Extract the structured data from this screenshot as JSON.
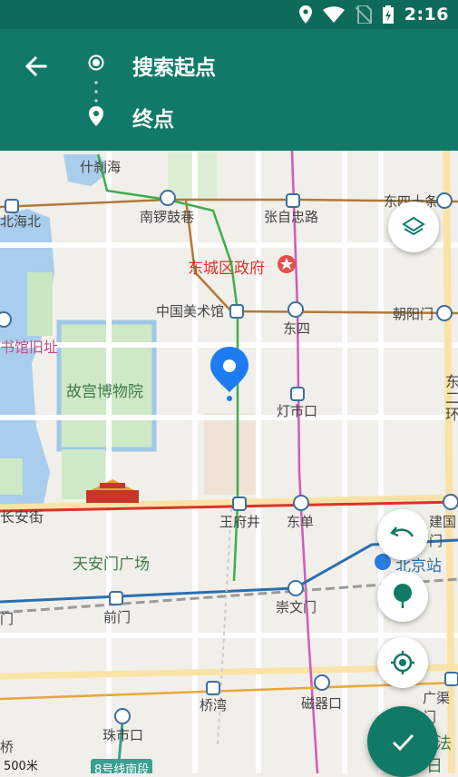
{
  "status_bar": {
    "time": "2:16"
  },
  "header": {
    "start_label": "搜索起点",
    "end_label": "终点"
  },
  "map": {
    "scale_label": "500米",
    "labels": {
      "shichahai": "什刹海",
      "beihaibei": "北海北",
      "nanluoguxiang": "南锣鼓巷",
      "zhangzizhonglu": "张自忠路",
      "dongsishitiao": "东四十条",
      "dongcheng_gov": "东城区政府",
      "meishuguan": "中国美术馆",
      "dongsi": "东四",
      "chaoyangmen": "朝阳门",
      "library": "书馆旧址",
      "palace_museum": "故宫博物院",
      "dengshikou": "灯市口",
      "huan": "东二环",
      "changanjie": "长安街",
      "wangfujing": "王府井",
      "dongdan": "东单",
      "jianguomen": "建国门",
      "tiananmen_square": "天安门广场",
      "beijing_station": "北京站",
      "qianmen": "前门",
      "chongwenmen": "崇文门",
      "men_left": "门",
      "qiaowan": "桥湾",
      "ciqikou": "磁器口",
      "guangqumen": "广渠门",
      "zhushikou": "珠市口",
      "qiao_left": "桥",
      "line8_south": "8号线南段",
      "fa_right": "法",
      "rizu_right": "日租"
    }
  },
  "colors": {
    "header": "#117a67",
    "statusbar": "#0e6b5a",
    "pin": "#1f7bf2"
  }
}
